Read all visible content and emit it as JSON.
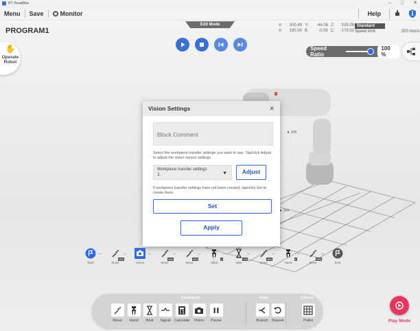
{
  "window": {
    "title": "RT VisualBox",
    "minimize": "–",
    "maximize": "□",
    "close": "✕"
  },
  "menubar": {
    "menu": "Menu",
    "save": "Save",
    "monitor": "Monitor",
    "help": "Help"
  },
  "header": {
    "program_name": "PROGRAM1",
    "mode": "Edit Mode",
    "coords": {
      "x_label": "X:",
      "x": "500.49",
      "y_label": "Y:",
      "y": "-44.06",
      "z_label": "Z:",
      "z": "535.06",
      "a_label": "A:",
      "a": "180.00",
      "b_label": "B:",
      "b": "-0.09",
      "c_label": "C:",
      "c": "-179.52"
    },
    "speed_mode": "Standard",
    "speed_limit_label": "Speed limit:",
    "speed_limit": "250 mm/s",
    "speed_ratio_label": "Speed Ratio",
    "speed_ratio": "100 %",
    "speed_ratio_fraction": 1.0
  },
  "operate_robot": {
    "line1": "Operate",
    "line2": "Robot"
  },
  "scene": {
    "point_label_1": "005",
    "point_label_2": "004"
  },
  "dialog": {
    "title": "Vision Settings",
    "close": "✕",
    "comment_placeholder": "Block Comment",
    "description": "Select the workpiece transfer settings you want to use. Tap/click Adjust to adjust the vision sensor settings.",
    "select_label": "Workpiece transfer settings",
    "select_value": "1",
    "adjust_label": "Adjust",
    "description2": "If workpiece transfer settings have not been created, tap/click Set to create them.",
    "set_label": "Set",
    "apply_label": "Apply"
  },
  "flow": {
    "nodes": [
      {
        "label": "Start",
        "icon": "flag-icon",
        "num": ""
      },
      {
        "label": "Move",
        "icon": "move-icon",
        "num": "001"
      },
      {
        "label": "Vision",
        "icon": "camera-icon",
        "num": ""
      },
      {
        "label": "Move",
        "icon": "move-icon",
        "num": "002"
      },
      {
        "label": "Move",
        "icon": "move-icon",
        "num": "003"
      },
      {
        "label": "Hand",
        "icon": "hand-icon",
        "num": "1"
      },
      {
        "label": "Wait",
        "icon": "hourglass-icon",
        "num": "0.5"
      },
      {
        "label": "Move",
        "icon": "move-icon",
        "num": "004"
      },
      {
        "label": "Hand",
        "icon": "hand-icon",
        "num": "2"
      },
      {
        "label": "Move",
        "icon": "move-icon",
        "num": "005"
      },
      {
        "label": "End",
        "icon": "end-icon",
        "num": ""
      }
    ]
  },
  "palette": {
    "groups": {
      "command": "Command",
      "flow": "Flow",
      "library": "Library"
    },
    "commands": [
      {
        "label": "Move",
        "icon": "move-icon"
      },
      {
        "label": "Hand",
        "icon": "hand-icon"
      },
      {
        "label": "Wait",
        "icon": "hourglass-icon"
      },
      {
        "label": "Signal",
        "icon": "signal-icon"
      },
      {
        "label": "Calculate",
        "icon": "calculator-icon"
      },
      {
        "label": "Vision",
        "icon": "camera-icon"
      },
      {
        "label": "Pause",
        "icon": "pause-icon"
      },
      {
        "label": "Branch",
        "icon": "branch-icon"
      },
      {
        "label": "Repeat",
        "icon": "repeat-icon"
      },
      {
        "label": "Pallet",
        "icon": "pallet-icon"
      }
    ]
  },
  "play_mode": {
    "label": "Play Mode"
  },
  "colors": {
    "accent": "#3a6fd8",
    "play_mode": "#e8365d",
    "dialog_button": "#2f6ad6"
  }
}
